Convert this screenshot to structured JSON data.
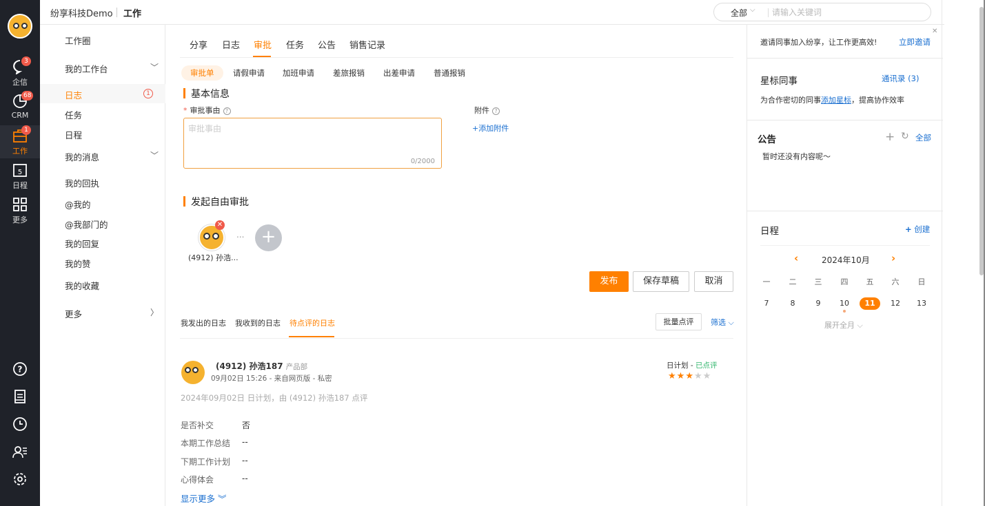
{
  "topbar": {
    "brand": "纷享科技Demo",
    "title": "工作",
    "search_scope": "全部",
    "search_placeholder": "请输入关键词"
  },
  "rail": {
    "items": [
      {
        "label": "企信",
        "badge": "3"
      },
      {
        "label": "CRM",
        "badge": "68"
      },
      {
        "label": "工作",
        "badge": "1"
      },
      {
        "label": "日程",
        "icon_text": "5"
      },
      {
        "label": "更多"
      }
    ]
  },
  "sidebar": {
    "items": [
      {
        "label": "工作圈"
      },
      {
        "label": "我的工作台"
      },
      {
        "label": "日志",
        "count": "1"
      },
      {
        "label": "任务"
      },
      {
        "label": "日程"
      },
      {
        "label": "我的消息"
      },
      {
        "label": "我的回执"
      },
      {
        "label": "@我的"
      },
      {
        "label": "@我部门的"
      },
      {
        "label": "我的回复"
      },
      {
        "label": "我的赞"
      },
      {
        "label": "我的收藏"
      },
      {
        "label": "更多"
      }
    ]
  },
  "main": {
    "tabs": [
      "分享",
      "日志",
      "审批",
      "任务",
      "公告",
      "销售记录"
    ],
    "subtabs": [
      "审批单",
      "请假申请",
      "加班申请",
      "差旅报销",
      "出差申请",
      "普通报销"
    ],
    "basic_info_title": "基本信息",
    "reason_label": "审批事由",
    "reason_placeholder": "审批事由",
    "reason_counter": "0/2000",
    "attachment_label": "附件",
    "add_attachment": "+添加附件",
    "free_approval_title": "发起自由审批",
    "approver_name": "(4912) 孙浩...",
    "dots": "...",
    "btn_publish": "发布",
    "btn_save_draft": "保存草稿",
    "btn_cancel": "取消",
    "log_tabs": [
      "我发出的日志",
      "我收到的日志",
      "待点评的日志"
    ],
    "bulk_review": "批量点评",
    "filter": "筛选",
    "log": {
      "author": "(4912) 孙浩187",
      "dept": "产品部",
      "meta": "09月02日 15:26 - 来自网页版 - 私密",
      "type": "日计划 - ",
      "status": "已点评",
      "rating": 3,
      "summary": "2024年09月02日 日计划，由 (4912) 孙浩187 点评",
      "rows": [
        {
          "k": "是否补交",
          "v": "否"
        },
        {
          "k": "本期工作总结",
          "v": "--"
        },
        {
          "k": "下期工作计划",
          "v": "--"
        },
        {
          "k": "心得体会",
          "v": "--"
        }
      ],
      "show_more": "显示更多"
    }
  },
  "right": {
    "invite_text": "邀请同事加入纷享，让工作更高效!",
    "invite_link": "立即邀请",
    "star_title": "星标同事",
    "contacts_link": "通讯录 (3)",
    "star_text_1": "为合作密切的同事",
    "star_link": "添加星标",
    "star_text_2": "，提高协作效率",
    "notice_title": "公告",
    "notice_all": "全部",
    "notice_empty": "暂时还没有内容呢～",
    "schedule_title": "日程",
    "schedule_create": "创建",
    "calendar_month": "2024年10月",
    "weekdays": [
      "一",
      "二",
      "三",
      "四",
      "五",
      "六",
      "日"
    ],
    "days": [
      "7",
      "8",
      "9",
      "10",
      "11",
      "12",
      "13"
    ],
    "today": "11",
    "expand": "展开全月"
  },
  "colors": {
    "accent": "#ff8000",
    "rail_bg": "#1f2229",
    "link": "#1a6fd0",
    "badge": "#f05a4a",
    "success": "#2fb56b"
  }
}
